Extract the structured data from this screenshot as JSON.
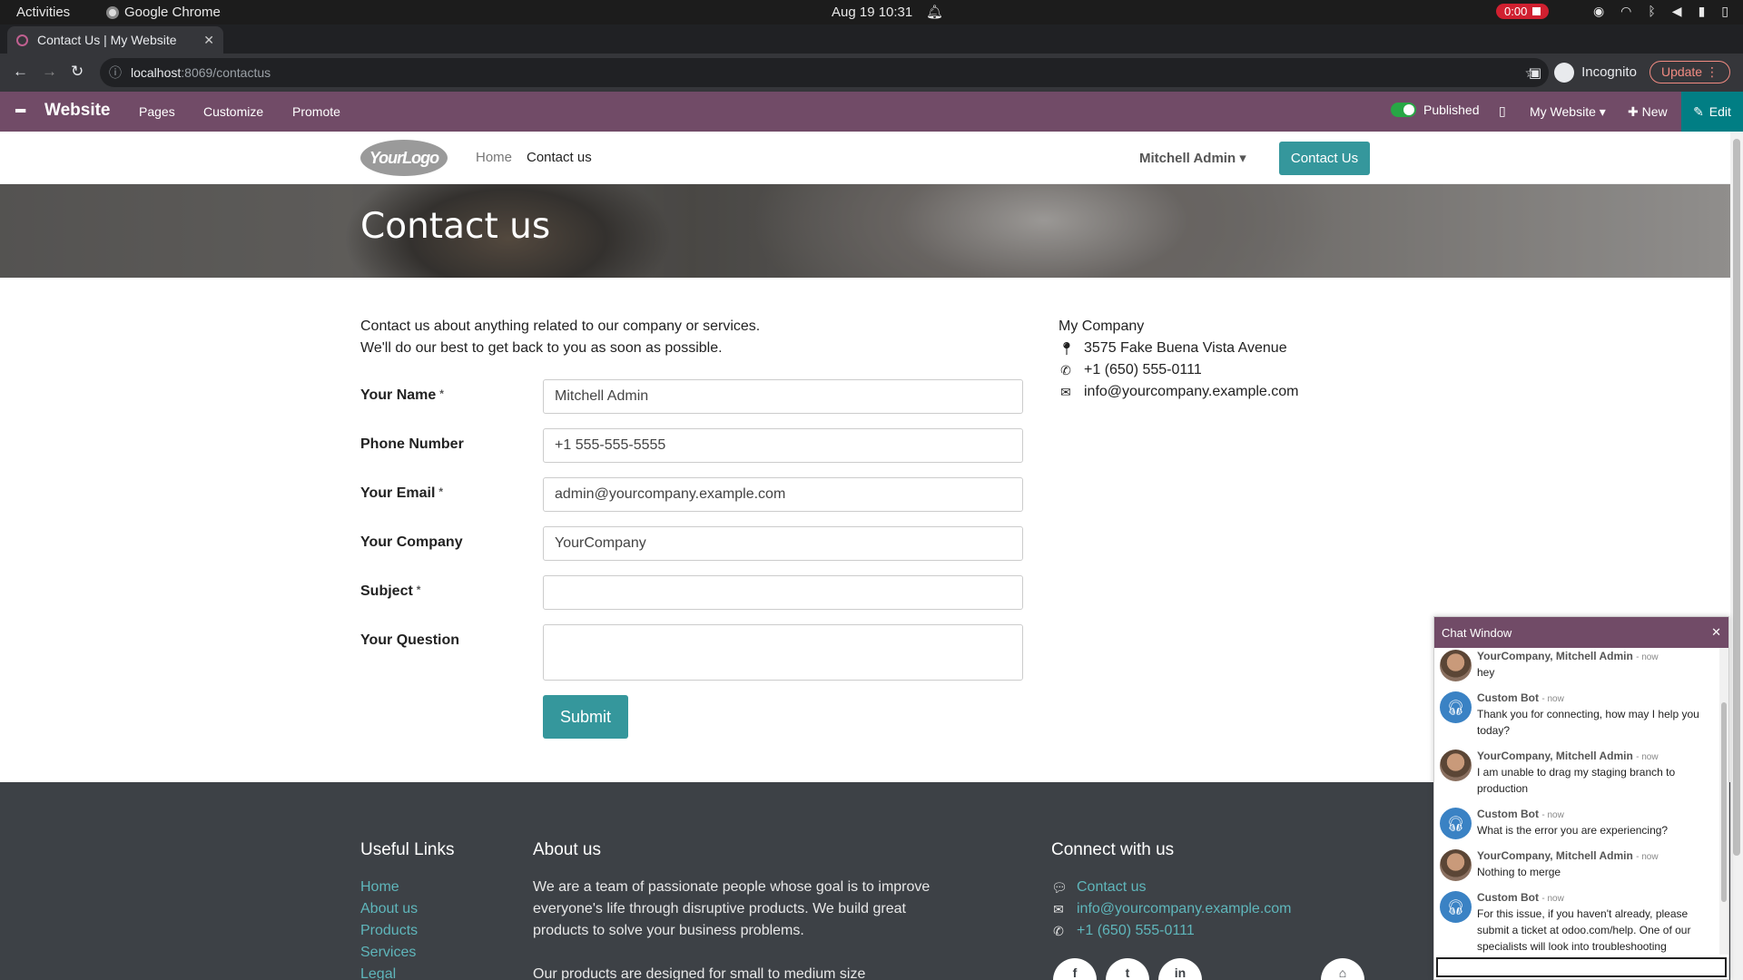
{
  "os": {
    "activities": "Activities",
    "app": "Google Chrome",
    "clock": "Aug 19  10:31",
    "rec": "0:00"
  },
  "browser": {
    "tab_title": "Contact Us | My Website",
    "url_host": "localhost",
    "url_path": ":8069/contactus",
    "incognito": "Incognito",
    "update": "Update"
  },
  "odoo": {
    "brand": "Website",
    "menu": [
      "Pages",
      "Customize",
      "Promote"
    ],
    "published": "Published",
    "my_website": "My Website",
    "new": "New",
    "edit": "Edit"
  },
  "header": {
    "logo": "YourLogo",
    "nav": [
      "Home",
      "Contact us"
    ],
    "user": "Mitchell Admin",
    "cta": "Contact Us"
  },
  "hero": {
    "title": "Contact us"
  },
  "intro": {
    "line1": "Contact us about anything related to our company or services.",
    "line2": "We'll do our best to get back to you as soon as possible."
  },
  "form": {
    "fields": [
      {
        "label": "Your Name",
        "required": true,
        "value": "Mitchell Admin"
      },
      {
        "label": "Phone Number",
        "required": false,
        "value": "+1 555-555-5555"
      },
      {
        "label": "Your Email",
        "required": true,
        "value": "admin@yourcompany.example.com"
      },
      {
        "label": "Your Company",
        "required": false,
        "value": "YourCompany"
      },
      {
        "label": "Subject",
        "required": true,
        "value": ""
      },
      {
        "label": "Your Question",
        "required": false,
        "value": ""
      }
    ],
    "required_mark": "*",
    "submit": "Submit"
  },
  "company": {
    "name": "My Company",
    "address": "3575 Fake Buena Vista Avenue",
    "phone": "+1 (650) 555-0111",
    "email": "info@yourcompany.example.com"
  },
  "footer": {
    "useful_title": "Useful Links",
    "useful_links": [
      "Home",
      "About us",
      "Products",
      "Services",
      "Legal"
    ],
    "about_title": "About us",
    "about_p1": "We are a team of passionate people whose goal is to improve everyone's life through disruptive products. We build great products to solve your business problems.",
    "about_p2": "Our products are designed for small to medium size",
    "connect_title": "Connect with us",
    "connect_contact": "Contact us",
    "connect_email": "info@yourcompany.example.com",
    "connect_phone": "+1 (650) 555-0111"
  },
  "chat": {
    "title": "Chat Window",
    "messages": [
      {
        "author": "YourCompany, Mitchell Admin",
        "when": "now",
        "text": "hey",
        "kind": "user"
      },
      {
        "author": "Custom Bot",
        "when": "now",
        "text": "Thank you for connecting, how may I help you today?",
        "kind": "bot"
      },
      {
        "author": "YourCompany, Mitchell Admin",
        "when": "now",
        "text": "I am unable to drag my staging branch to production",
        "kind": "user"
      },
      {
        "author": "Custom Bot",
        "when": "now",
        "text": "What is the error you are experiencing?",
        "kind": "bot"
      },
      {
        "author": "YourCompany, Mitchell Admin",
        "when": "now",
        "text": "Nothing to merge",
        "kind": "user"
      },
      {
        "author": "Custom Bot",
        "when": "now",
        "text": "For this issue, if you haven't already, please submit a ticket at odoo.com/help. One of our specialists will look into troubleshooting",
        "kind": "bot"
      }
    ]
  }
}
